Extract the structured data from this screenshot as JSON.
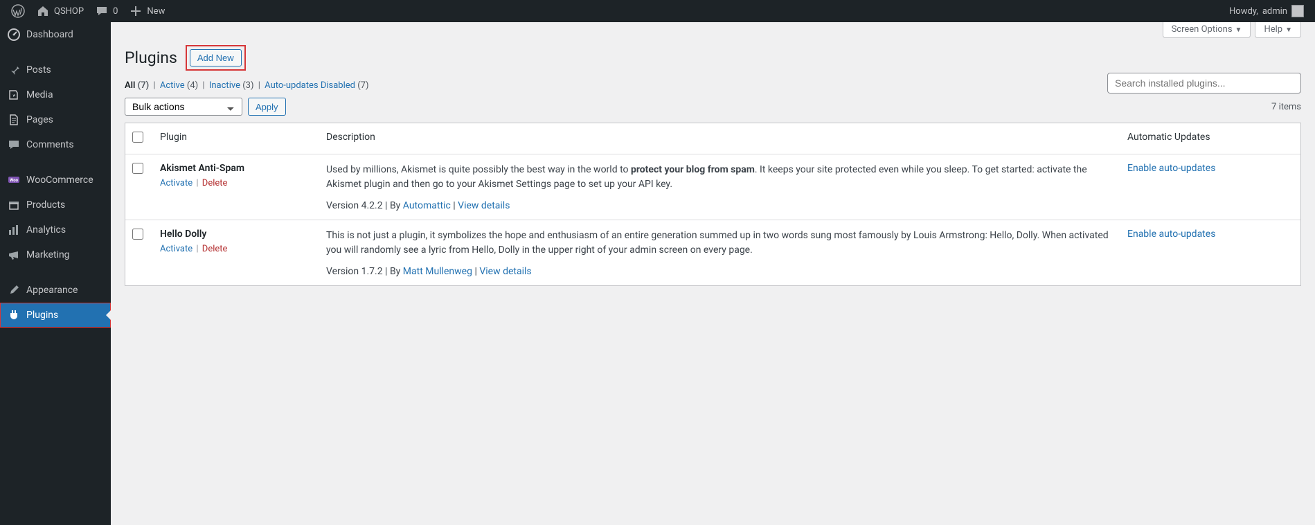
{
  "adminbar": {
    "site_name": "QSHOP",
    "comments_count": "0",
    "new_label": "New",
    "howdy_prefix": "Howdy, ",
    "user": "admin"
  },
  "sidebar": {
    "items": [
      {
        "label": "Dashboard",
        "icon": "dashboard"
      },
      {
        "label": "Posts",
        "icon": "pin"
      },
      {
        "label": "Media",
        "icon": "media"
      },
      {
        "label": "Pages",
        "icon": "page"
      },
      {
        "label": "Comments",
        "icon": "comment"
      },
      {
        "label": "WooCommerce",
        "icon": "woo"
      },
      {
        "label": "Products",
        "icon": "archive"
      },
      {
        "label": "Analytics",
        "icon": "chart"
      },
      {
        "label": "Marketing",
        "icon": "megaphone"
      },
      {
        "label": "Appearance",
        "icon": "brush"
      },
      {
        "label": "Plugins",
        "icon": "plug"
      }
    ]
  },
  "meta": {
    "screen_options": "Screen Options",
    "help": "Help"
  },
  "heading": {
    "title": "Plugins",
    "add_new": "Add New"
  },
  "filters": {
    "all_label": "All",
    "all_count": "(7)",
    "active_label": "Active",
    "active_count": "(4)",
    "inactive_label": "Inactive",
    "inactive_count": "(3)",
    "auto_disabled_label": "Auto-updates Disabled",
    "auto_disabled_count": "(7)"
  },
  "search": {
    "placeholder": "Search installed plugins..."
  },
  "bulk": {
    "label": "Bulk actions",
    "apply": "Apply"
  },
  "count_text": "7 items",
  "table": {
    "cols": {
      "plugin": "Plugin",
      "description": "Description",
      "auto": "Automatic Updates"
    },
    "rows": [
      {
        "name": "Akismet Anti-Spam",
        "activate": "Activate",
        "delete": "Delete",
        "desc_pre": "Used by millions, Akismet is quite possibly the best way in the world to ",
        "desc_strong": "protect your blog from spam",
        "desc_post": ". It keeps your site protected even while you sleep. To get started: activate the Akismet plugin and then go to your Akismet Settings page to set up your API key.",
        "version_prefix": "Version 4.2.2 | By ",
        "author": "Automattic",
        "view_details": "View details",
        "auto_link": "Enable auto-updates"
      },
      {
        "name": "Hello Dolly",
        "activate": "Activate",
        "delete": "Delete",
        "desc_pre": "This is not just a plugin, it symbolizes the hope and enthusiasm of an entire generation summed up in two words sung most famously by Louis Armstrong: Hello, Dolly. When activated you will randomly see a lyric from Hello, Dolly in the upper right of your admin screen on every page.",
        "desc_strong": "",
        "desc_post": "",
        "version_prefix": "Version 1.7.2 | By ",
        "author": "Matt Mullenweg",
        "view_details": "View details",
        "auto_link": "Enable auto-updates"
      }
    ]
  }
}
